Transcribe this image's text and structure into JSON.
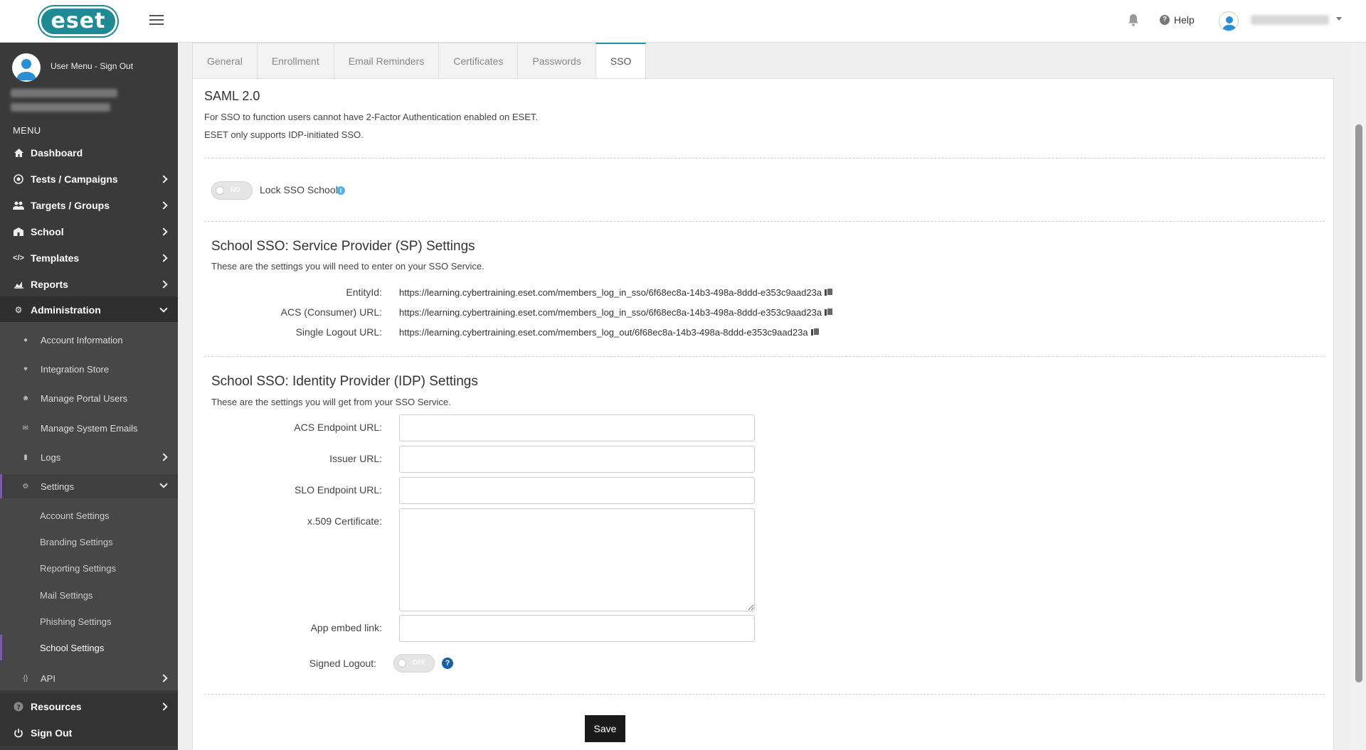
{
  "header": {
    "logo_text": "eset",
    "help_label": "Help"
  },
  "sidebar": {
    "user_menu": "User Menu -  Sign Out",
    "menu_label": "MENU",
    "items": [
      {
        "label": "Dashboard",
        "icon": "home-icon"
      },
      {
        "label": "Tests / Campaigns",
        "icon": "target-icon"
      },
      {
        "label": "Targets / Groups",
        "icon": "users-icon"
      },
      {
        "label": "School",
        "icon": "school-icon"
      },
      {
        "label": "Templates",
        "icon": "code-icon"
      },
      {
        "label": "Reports",
        "icon": "chart-icon"
      },
      {
        "label": "Administration",
        "icon": "cogs-icon"
      }
    ],
    "admin_sub": [
      {
        "label": "Account Information"
      },
      {
        "label": "Integration Store"
      },
      {
        "label": "Manage Portal Users"
      },
      {
        "label": "Manage System Emails"
      },
      {
        "label": "Logs"
      },
      {
        "label": "Settings"
      }
    ],
    "settings_sub": [
      {
        "label": "Account Settings"
      },
      {
        "label": "Branding Settings"
      },
      {
        "label": "Reporting Settings"
      },
      {
        "label": "Mail Settings"
      },
      {
        "label": "Phishing Settings"
      },
      {
        "label": "School Settings"
      }
    ],
    "api_label": "API",
    "resources_label": "Resources",
    "signout_label": "Sign Out"
  },
  "tabs": [
    "General",
    "Enrollment",
    "Email Reminders",
    "Certificates",
    "Passwords",
    "SSO"
  ],
  "active_tab": "SSO",
  "saml": {
    "title": "SAML 2.0",
    "note1": "For SSO to function users cannot have 2-Factor Authentication enabled on ESET.",
    "note2": "ESET only supports IDP-initiated SSO.",
    "lock_toggle": "NO",
    "lock_label": "Lock SSO School"
  },
  "sp": {
    "title": "School SSO: Service Provider (SP) Settings",
    "subtitle": "These are the settings you will need to enter on your SSO Service.",
    "rows": [
      {
        "label": "EntityId:",
        "value": "https://learning.cybertraining.eset.com/members_log_in_sso/6f68ec8a-14b3-498a-8ddd-e353c9aad23a"
      },
      {
        "label": "ACS (Consumer) URL:",
        "value": "https://learning.cybertraining.eset.com/members_log_in_sso/6f68ec8a-14b3-498a-8ddd-e353c9aad23a"
      },
      {
        "label": "Single Logout URL:",
        "value": "https://learning.cybertraining.eset.com/members_log_out/6f68ec8a-14b3-498a-8ddd-e353c9aad23a"
      }
    ]
  },
  "idp": {
    "title": "School SSO: Identity Provider (IDP) Settings",
    "subtitle": "These are the settings you will get from your SSO Service.",
    "acs_label": "ACS Endpoint URL:",
    "issuer_label": "Issuer URL:",
    "slo_label": "SLO Endpoint URL:",
    "cert_label": "x.509 Certificate:",
    "embed_label": "App embed link:",
    "signed_logout_label": "Signed Logout:",
    "signed_logout_toggle": "OFF"
  },
  "save_label": "Save"
}
